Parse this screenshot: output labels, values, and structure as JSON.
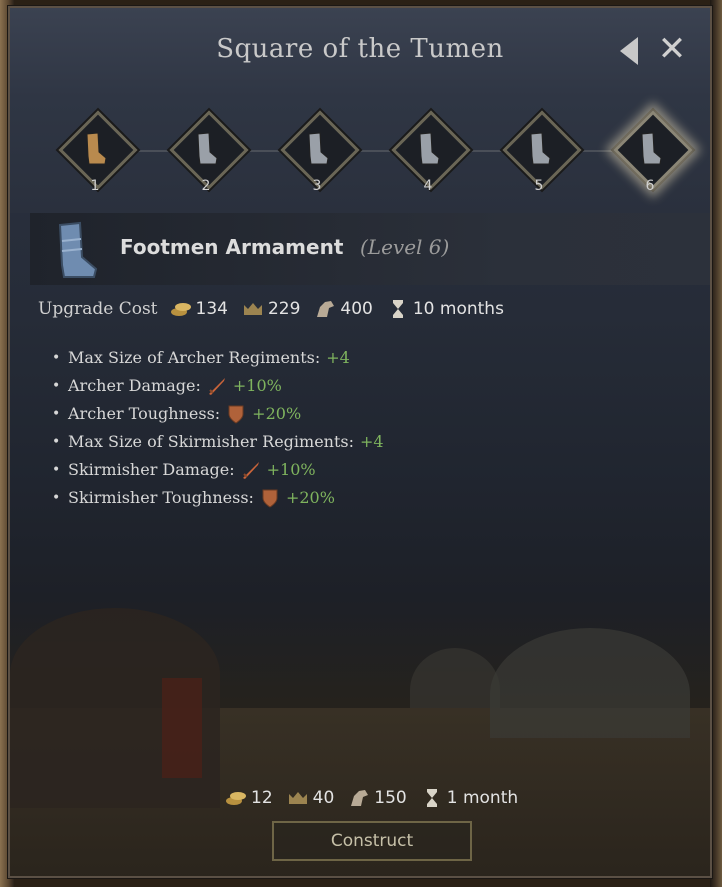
{
  "panel": {
    "title": "Square of the Tumen",
    "back_icon": "back-arrow-icon",
    "close_icon": "close-icon",
    "close_glyph": "✕"
  },
  "levels": {
    "items": [
      {
        "label": "1",
        "state": "owned",
        "color": "#b98a4e"
      },
      {
        "label": "2",
        "state": "locked",
        "color": "#9aa0a8"
      },
      {
        "label": "3",
        "state": "locked",
        "color": "#9aa0a8"
      },
      {
        "label": "4",
        "state": "locked",
        "color": "#9aa0a8"
      },
      {
        "label": "5",
        "state": "locked",
        "color": "#9aa0a8"
      },
      {
        "label": "6",
        "state": "selected",
        "color": "#9aa0a8"
      }
    ]
  },
  "item": {
    "name": "Footmen Armament",
    "level_text": "(Level 6)",
    "icon": "boot-icon"
  },
  "upgrade_cost": {
    "label": "Upgrade Cost",
    "gold": "134",
    "prestige": "229",
    "horses": "400",
    "time": "10 months"
  },
  "effects": [
    {
      "text": "Max Size of Archer Regiments:",
      "icon": null,
      "value": "+4"
    },
    {
      "text": "Archer Damage:",
      "icon": "sword-icon",
      "value": "+10%"
    },
    {
      "text": "Archer Toughness:",
      "icon": "shield-icon",
      "value": "+20%"
    },
    {
      "text": "Max Size of Skirmisher Regiments:",
      "icon": null,
      "value": "+4"
    },
    {
      "text": "Skirmisher Damage:",
      "icon": "sword-icon",
      "value": "+10%"
    },
    {
      "text": "Skirmisher Toughness:",
      "icon": "shield-icon",
      "value": "+20%"
    }
  ],
  "construct": {
    "gold": "12",
    "prestige": "40",
    "horses": "150",
    "time": "1 month",
    "button_label": "Construct"
  },
  "colors": {
    "positive": "#7fb45e",
    "accent_gold": "#c9a24a"
  }
}
